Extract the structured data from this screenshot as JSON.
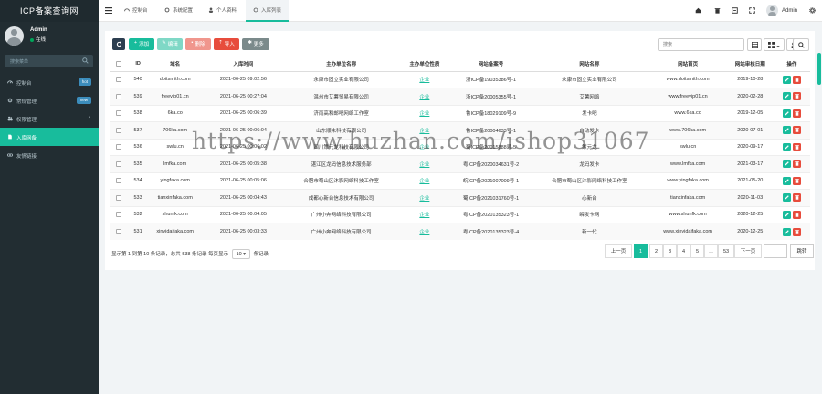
{
  "app": {
    "title": "ICP备案查询网"
  },
  "user": {
    "name": "Admin",
    "status": "在线"
  },
  "sidebar": {
    "search_placeholder": "搜索菜单",
    "items": [
      {
        "label": "控制台",
        "icon": "dashboard-icon",
        "badge": "hot",
        "active": false
      },
      {
        "label": "常规管理",
        "icon": "cogs-icon",
        "badge": "new",
        "active": false
      },
      {
        "label": "权限管理",
        "icon": "group-icon",
        "badge": "",
        "active": false
      },
      {
        "label": "入库网备",
        "icon": "file-icon",
        "badge": "",
        "active": true
      },
      {
        "label": "友情链接",
        "icon": "link-icon",
        "badge": "",
        "active": false
      }
    ]
  },
  "topbar": {
    "tabs": [
      {
        "label": "控制台",
        "icon": "dashboard-icon"
      },
      {
        "label": "系统配置",
        "icon": "gear-icon"
      },
      {
        "label": "个人资料",
        "icon": "user-icon"
      },
      {
        "label": "入库列表",
        "icon": "refresh-icon"
      }
    ],
    "user_name": "Admin"
  },
  "toolbar": {
    "add_label": "添加",
    "edit_label": "编辑",
    "delete_label": "删除",
    "import_label": "导入",
    "more_label": "更多",
    "search_placeholder": "搜索"
  },
  "table": {
    "headers": [
      "ID",
      "域名",
      "入库时间",
      "主办单位名称",
      "主办单位性质",
      "网站备案号",
      "网站名称",
      "网站首页",
      "网站审核日期",
      "操作"
    ],
    "rows": [
      [
        "540",
        "doitsmith.com",
        "2021-06-25 09:02:56",
        "永康市固立实业有限公司",
        "企业",
        "浙ICP备19035386号-1",
        "永康市固立实业有限公司",
        "www.doitsmith.com",
        "2019-10-28"
      ],
      [
        "539",
        "freevip01.cn",
        "2021-06-25 00:27:04",
        "温州市艾薯贸易有限公司",
        "企业",
        "浙ICP备20005355号-1",
        "艾薯网络",
        "www.freevip01.cn",
        "2020-02-28"
      ],
      [
        "538",
        "6ka.co",
        "2021-06-25 00:06:39",
        "济南高和邮吧网络工作室",
        "企业",
        "鲁ICP备18029109号-9",
        "发卡吧",
        "www.6ka.co",
        "2019-12-05"
      ],
      [
        "537",
        "706ka.com",
        "2021-06-25 00:06:04",
        "山东顺未科技有限公司",
        "企业",
        "鲁ICP备20004633号-1",
        "自动发卡",
        "www.706ka.com",
        "2020-07-01"
      ],
      [
        "536",
        "swlu.cn",
        "2021-06-25 00:06:02",
        "四川策元龙科技有限公司",
        "企业",
        "蜀ICP备20015888号-5",
        "策元龙",
        "swlu.cn",
        "2020-09-17"
      ],
      [
        "535",
        "lmfka.com",
        "2021-06-25 00:05:38",
        "湛江区龙码信息技术服务部",
        "企业",
        "粤ICP备2020034631号-2",
        "龙码发卡",
        "www.lmfka.com",
        "2021-03-17"
      ],
      [
        "534",
        "yingfaka.com",
        "2021-06-25 00:05:06",
        "合肥市蜀山区沐影网络科技工作室",
        "企业",
        "皖ICP备2021007009号-1",
        "合肥市蜀山区沐影网络科技工作室",
        "www.yingfaka.com",
        "2021-05-20"
      ],
      [
        "533",
        "tianxinfaka.com",
        "2021-06-25 00:04:43",
        "成都心新台信息技术有限公司",
        "企业",
        "蜀ICP备2021031760号-1",
        "心新台",
        "tianxinfaka.com",
        "2020-11-03"
      ],
      [
        "532",
        "shunfk.com",
        "2021-06-25 00:04:05",
        "广州小奔网络科技有限公司",
        "企业",
        "粤ICP备2020135323号-1",
        "瞬发卡网",
        "www.shunfk.com",
        "2020-12-25"
      ],
      [
        "531",
        "xinyidaifaka.com",
        "2021-06-25 00:03:33",
        "广州小奔网络科技有限公司",
        "企业",
        "粤ICP备2020135323号-4",
        "新一代",
        "www.xinyidaifaka.com",
        "2020-12-25"
      ]
    ]
  },
  "footer": {
    "info_prefix": "显示第 1 到第 10 条记录，总共 538 条记录 每页显示",
    "page_size": "10",
    "info_suffix": "条记录"
  },
  "pagination": {
    "prev": "上一页",
    "pages": [
      "1",
      "2",
      "3",
      "4",
      "5",
      "...",
      "53"
    ],
    "next": "下一页",
    "jump": "跳转",
    "current": "1"
  },
  "watermark": "https://www.huzhan.com/ishop31067",
  "colors": {
    "sidebar": "#222d32",
    "accent": "#18bc9c",
    "danger": "#e74c3c",
    "warning": "#f39c12",
    "primary": "#2c3e50"
  }
}
